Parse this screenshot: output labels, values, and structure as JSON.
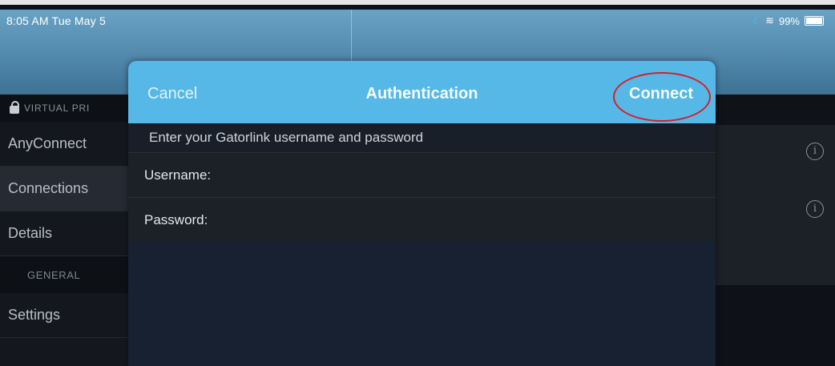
{
  "status_bar": {
    "time": "8:05 AM  Tue May 5",
    "battery": "99%"
  },
  "sidebar": {
    "section_label": "VIRTUAL PRI",
    "items": [
      {
        "label": "AnyConnect"
      },
      {
        "label": "Connections"
      },
      {
        "label": "Details"
      }
    ],
    "general_label": "GENERAL",
    "settings_label": "Settings"
  },
  "dialog": {
    "cancel_label": "Cancel",
    "title": "Authentication",
    "connect_label": "Connect",
    "prompt": "Enter your Gatorlink username and password",
    "username_label": "Username:",
    "password_label": "Password:",
    "username_value": "",
    "password_value": ""
  },
  "colors": {
    "header_blue": "#56b8e6",
    "annotation_red": "#d81e2a"
  }
}
